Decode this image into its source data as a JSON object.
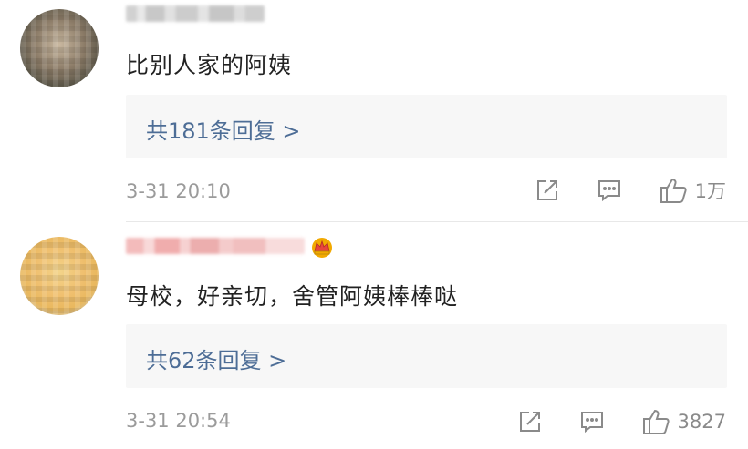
{
  "comments": [
    {
      "text": "比别人家的阿姨",
      "replies_label": "共181条回复 >",
      "timestamp": "3-31 20:10",
      "likes": "1万",
      "actions": [
        "share-icon",
        "comment-icon",
        "like-icon"
      ]
    },
    {
      "text": "母校，好亲切，舍管阿姨棒棒哒",
      "replies_label": "共62条回复 >",
      "timestamp": "3-31 20:54",
      "likes": "3827",
      "badge": "crown-icon",
      "actions": [
        "share-icon",
        "comment-icon",
        "like-icon"
      ]
    }
  ],
  "colors": {
    "link": "#4d6d96",
    "meta": "#9b9b9b",
    "reply_bg": "#f7f7f7",
    "badge_gold": "#f2a900",
    "badge_red": "#e8453c"
  }
}
